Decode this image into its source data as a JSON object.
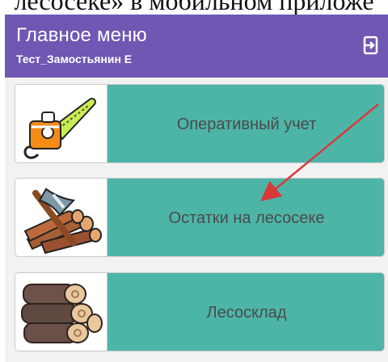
{
  "caption": {
    "text": "лесосеке» в мобильном приложе"
  },
  "header": {
    "title": "Главное меню",
    "subtitle": "Тест_Замостьянин Е",
    "exit_icon": "logout-icon"
  },
  "menu": {
    "items": [
      {
        "label": "Оперативный учет",
        "icon": "chainsaw-icon"
      },
      {
        "label": "Остатки на лесосеке",
        "icon": "axe-logs-icon"
      },
      {
        "label": "Лесосклад",
        "icon": "log-stack-icon"
      }
    ]
  },
  "colors": {
    "appbar": "#6f57b3",
    "card_accent": "#4db5a8",
    "arrow": "#d83a3a"
  }
}
